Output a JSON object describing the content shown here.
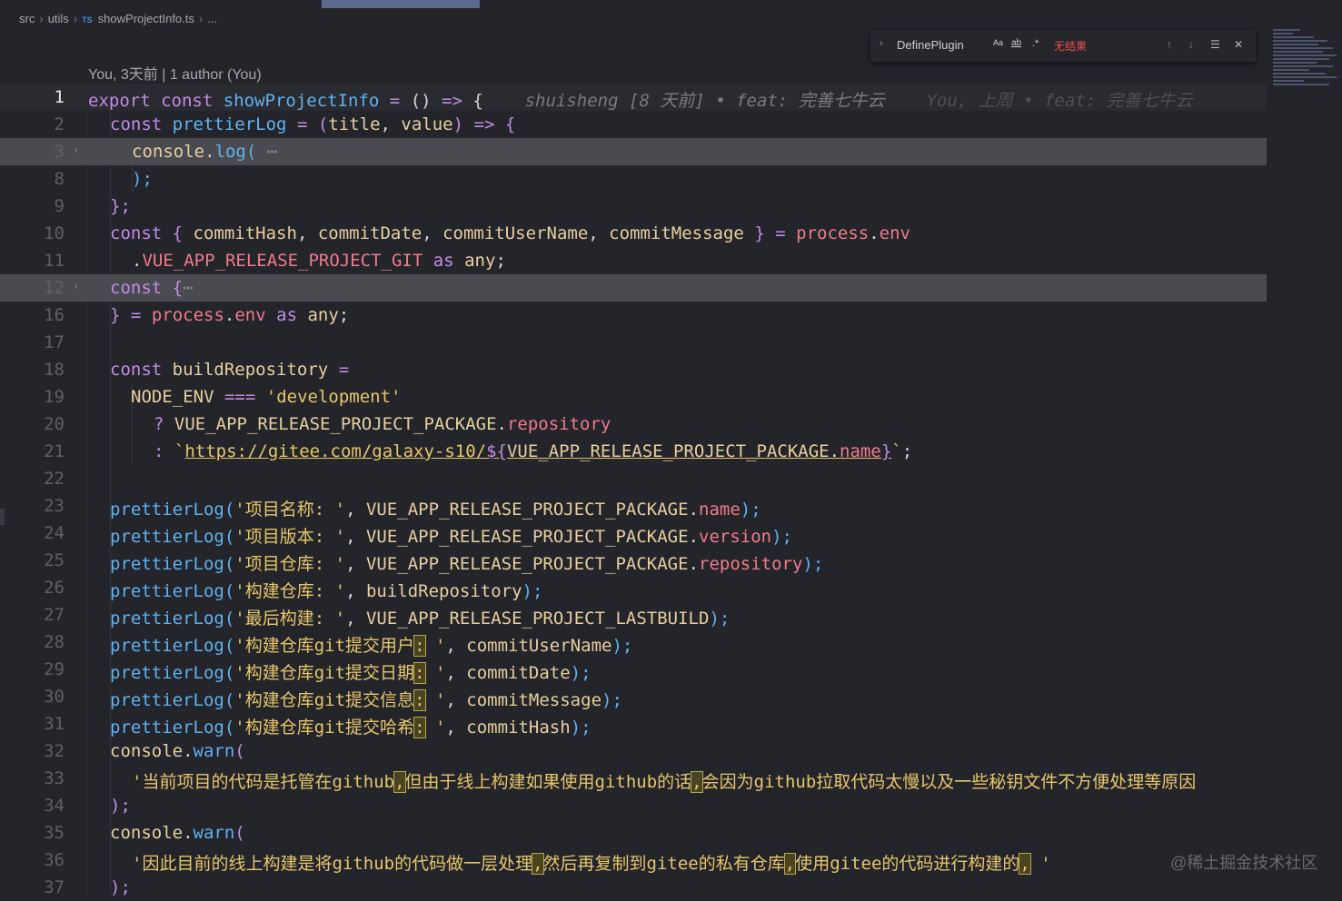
{
  "breadcrumb": {
    "items": [
      "src",
      "utils",
      "showProjectInfo.ts",
      "..."
    ],
    "file_badge": "TS"
  },
  "find_widget": {
    "query": "DefinePlugin",
    "match_case_label": "Aa",
    "whole_word_label": "ab",
    "regex_label": ".*",
    "result_text": "无结果"
  },
  "codelens": "You, 3天前 | 1 author (You)",
  "blame": {
    "line1": "shuisheng [8 天前] • feat: 完善七牛云",
    "line1_ghost": "You, 上周 • feat: 完善七牛云"
  },
  "line_numbers": [
    "1",
    "2",
    "3",
    "8",
    "9",
    "10",
    "11",
    "12",
    "16",
    "17",
    "18",
    "19",
    "20",
    "21",
    "22",
    "23",
    "24",
    "25",
    "26",
    "27",
    "28",
    "29",
    "30",
    "31",
    "32",
    "33",
    "34",
    "35",
    "36",
    "37"
  ],
  "code": {
    "l1": [
      "export",
      "const",
      "showProjectInfo",
      "=",
      "()",
      "=>",
      "{"
    ],
    "l2": [
      "const",
      "prettierLog",
      "=",
      "(",
      "title",
      ", ",
      "value",
      ")",
      "=>",
      "{"
    ],
    "l3": [
      "console",
      ".",
      "log",
      "(",
      "⋯"
    ],
    "l8": [
      ");"
    ],
    "l9": [
      "};"
    ],
    "l10": [
      "const",
      "{ ",
      "commitHash",
      ", ",
      "commitDate",
      ", ",
      "commitUserName",
      ", ",
      "commitMessage",
      " }",
      "=",
      "process",
      ".",
      "env"
    ],
    "l11": [
      ".",
      "VUE_APP_RELEASE_PROJECT_GIT",
      "as",
      "any",
      ";"
    ],
    "l12": [
      "const",
      "{",
      "⋯"
    ],
    "l16": [
      "}",
      "=",
      "process",
      ".",
      "env",
      "as",
      "any",
      ";"
    ],
    "l18": [
      "const",
      "buildRepository",
      "="
    ],
    "l19": [
      "NODE_ENV",
      "===",
      "'development'"
    ],
    "l20": [
      "?",
      "VUE_APP_RELEASE_PROJECT_PACKAGE",
      ".",
      "repository"
    ],
    "l21": [
      ":",
      "`",
      "https://gitee.com/galaxy-s10/",
      "${",
      "VUE_APP_RELEASE_PROJECT_PACKAGE",
      ".",
      "name",
      "}",
      "`",
      ";"
    ],
    "l23": [
      "prettierLog",
      "(",
      "'项目名称: '",
      ", ",
      "VUE_APP_RELEASE_PROJECT_PACKAGE",
      ".",
      "name",
      ");"
    ],
    "l24": [
      "prettierLog",
      "(",
      "'项目版本: '",
      ", ",
      "VUE_APP_RELEASE_PROJECT_PACKAGE",
      ".",
      "version",
      ");"
    ],
    "l25": [
      "prettierLog",
      "(",
      "'项目仓库: '",
      ", ",
      "VUE_APP_RELEASE_PROJECT_PACKAGE",
      ".",
      "repository",
      ");"
    ],
    "l26": [
      "prettierLog",
      "(",
      "'构建仓库: '",
      ", ",
      "buildRepository",
      ");"
    ],
    "l27": [
      "prettierLog",
      "(",
      "'最后构建: '",
      ", ",
      "VUE_APP_RELEASE_PROJECT_LASTBUILD",
      ");"
    ],
    "l28": [
      "prettierLog",
      "(",
      "'构建仓库git提交用户",
      ":",
      " '",
      ", ",
      "commitUserName",
      ");"
    ],
    "l29": [
      "prettierLog",
      "(",
      "'构建仓库git提交日期",
      ":",
      " '",
      ", ",
      "commitDate",
      ");"
    ],
    "l30": [
      "prettierLog",
      "(",
      "'构建仓库git提交信息",
      ":",
      " '",
      ", ",
      "commitMessage",
      ");"
    ],
    "l31": [
      "prettierLog",
      "(",
      "'构建仓库git提交哈希",
      ":",
      " '",
      ", ",
      "commitHash",
      ");"
    ],
    "l32": [
      "console",
      ".",
      "warn",
      "("
    ],
    "l33": [
      "'当前项目的代码是托管在github",
      ",",
      "但由于线上构建如果使用github的话",
      ",",
      "会因为github拉取代码太慢以及一些秘钥文件不方便处理等原因"
    ],
    "l34": [
      ");"
    ],
    "l35": [
      "console",
      ".",
      "warn",
      "("
    ],
    "l36": [
      "'因此目前的线上构建是将github的代码做一层处理",
      ",",
      "然后再复制到gitee的私有仓库",
      ",",
      "使用gitee的代码进行构建的",
      ",",
      " '"
    ],
    "l37": [
      ");"
    ]
  },
  "watermark": "@稀土掘金技术社区",
  "colors": {
    "background": "#24242b",
    "keyword": "#c28ce4",
    "function": "#5fb3f0",
    "string": "#e6c76a",
    "variable": "#e8cf9e",
    "property": "#f07c8a",
    "find_no_result": "#f0504a"
  }
}
